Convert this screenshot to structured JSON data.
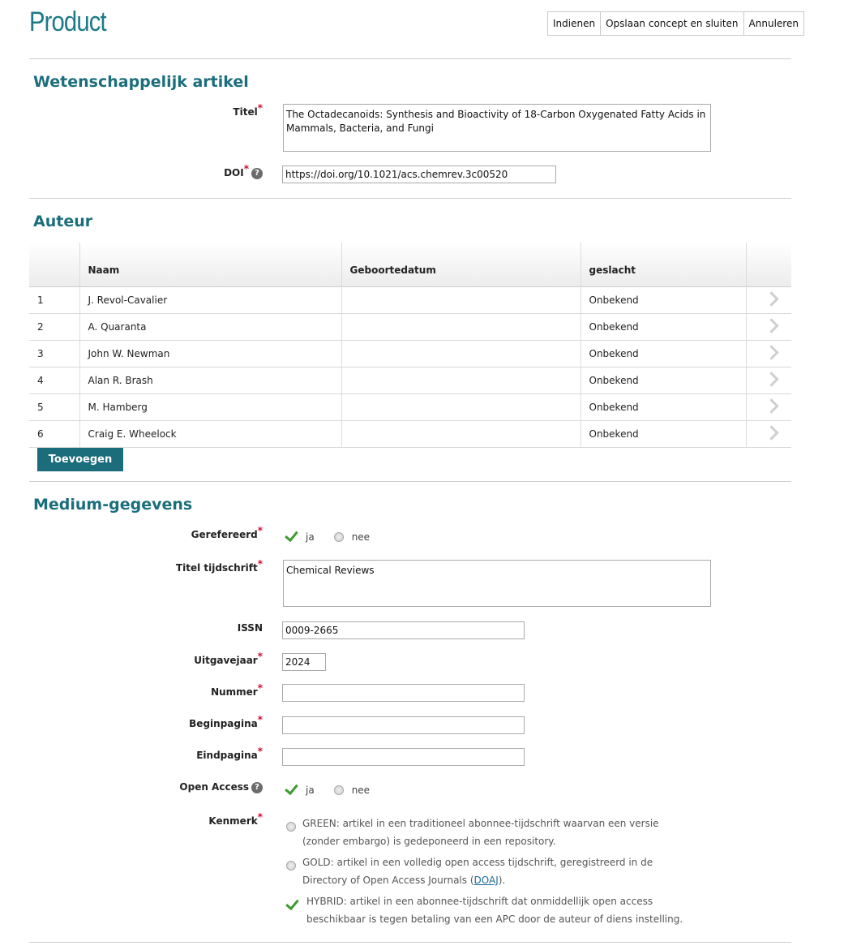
{
  "page_title": "Product",
  "toolbar": {
    "submit": "Indienen",
    "save_draft": "Opslaan concept en sluiten",
    "cancel": "Annuleren"
  },
  "article": {
    "section_title": "Wetenschappelijk artikel",
    "title_label": "Titel",
    "title_value": "The Octadecanoids: Synthesis and Bioactivity of 18-Carbon Oxygenated Fatty Acids in Mammals, Bacteria, and Fungi",
    "doi_label": "DOI",
    "doi_value": "https://doi.org/10.1021/acs.chemrev.3c00520"
  },
  "authors": {
    "section_title": "Auteur",
    "columns": [
      "",
      "Naam",
      "Geboortedatum",
      "geslacht",
      ""
    ],
    "rows": [
      {
        "nr": "1",
        "name": "J. Revol-Cavalier",
        "birthdate": "",
        "gender": "Onbekend"
      },
      {
        "nr": "2",
        "name": "A. Quaranta",
        "birthdate": "",
        "gender": "Onbekend"
      },
      {
        "nr": "3",
        "name": "John W. Newman",
        "birthdate": "",
        "gender": "Onbekend"
      },
      {
        "nr": "4",
        "name": "Alan R. Brash",
        "birthdate": "",
        "gender": "Onbekend"
      },
      {
        "nr": "5",
        "name": "M. Hamberg",
        "birthdate": "",
        "gender": "Onbekend"
      },
      {
        "nr": "6",
        "name": "Craig E. Wheelock",
        "birthdate": "",
        "gender": "Onbekend"
      }
    ],
    "add_button": "Toevoegen"
  },
  "medium": {
    "section_title": "Medium-gegevens",
    "refereed_label": "Gerefereerd",
    "yes": "ja",
    "no": "nee",
    "refereed_selected": "ja",
    "journal_label": "Titel tijdschrift",
    "journal_value": "Chemical Reviews",
    "issn_label": "ISSN",
    "issn_value": "0009-2665",
    "year_label": "Uitgavejaar",
    "year_value": "2024",
    "number_label": "Nummer",
    "number_value": "",
    "start_page_label": "Beginpagina",
    "start_page_value": "",
    "end_page_label": "Eindpagina",
    "end_page_value": "",
    "open_access_label": "Open Access",
    "open_access_selected": "ja",
    "kenmerk_label": "Kenmerk",
    "kenmerk_options": {
      "green": "GREEN: artikel in een traditioneel abonnee-tijdschrift waarvan een versie (zonder embargo) is gedeponeerd in een repository.",
      "gold_prefix": "GOLD: artikel in een volledig open access tijdschrift, geregistreerd in de Directory of Open Access Journals",
      "gold_link": "DOAJ",
      "hybrid": "HYBRID: artikel in een abonnee-tijdschrift dat onmiddellijk open access beschikbaar is tegen betaling van een APC door de auteur of diens instelling."
    },
    "kenmerk_selected": "hybrid"
  },
  "colors": {
    "accent": "#1b6e7c",
    "required": "#c8102e",
    "check": "#3b9b2d"
  }
}
